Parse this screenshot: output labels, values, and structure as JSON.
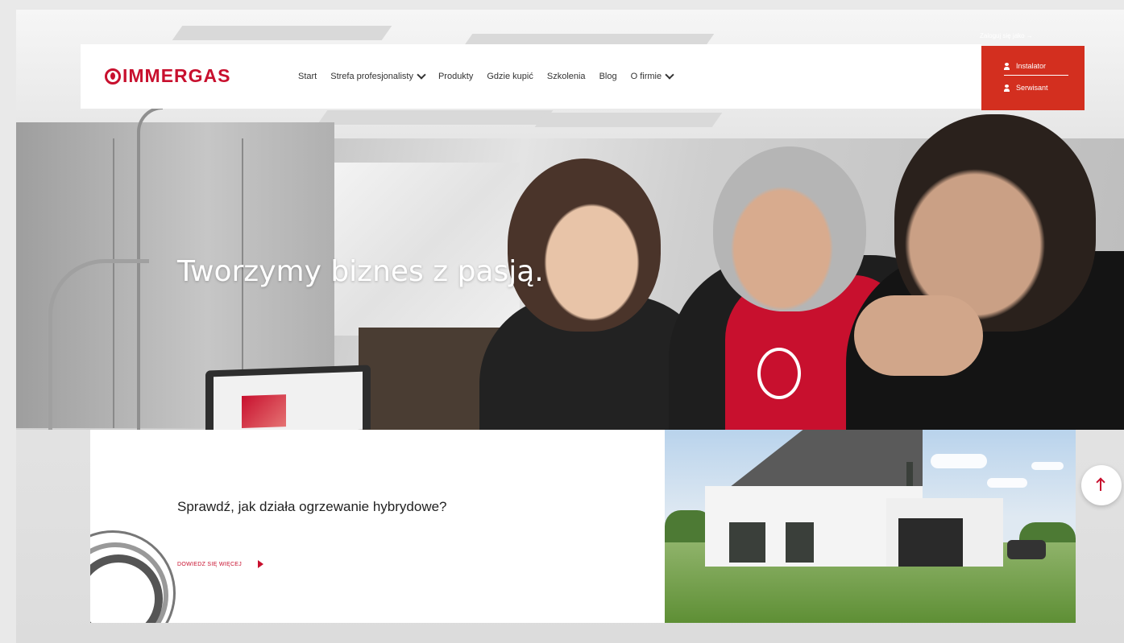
{
  "brand": {
    "name": "IMMERGAS",
    "accent": "#c8102e",
    "login_bg": "#d32f1f"
  },
  "nav": {
    "items": [
      {
        "label": "Start",
        "dropdown": false
      },
      {
        "label": "Strefa profesjonalisty",
        "dropdown": true
      },
      {
        "label": "Produkty",
        "dropdown": false
      },
      {
        "label": "Gdzie kupić",
        "dropdown": false
      },
      {
        "label": "Szkolenia",
        "dropdown": false
      },
      {
        "label": "Blog",
        "dropdown": false
      },
      {
        "label": "O firmie",
        "dropdown": true
      }
    ]
  },
  "login": {
    "link_label": "Zaloguj się jako →",
    "instalator_label": "Instalator",
    "serwisant_label": "Serwisant"
  },
  "hero": {
    "title": "Tworzymy biznes z pasją."
  },
  "promo": {
    "title": "Sprawdź, jak działa ogrzewanie hybrydowe?",
    "link_label": "DOWIEDZ SIĘ WIĘCEJ"
  }
}
